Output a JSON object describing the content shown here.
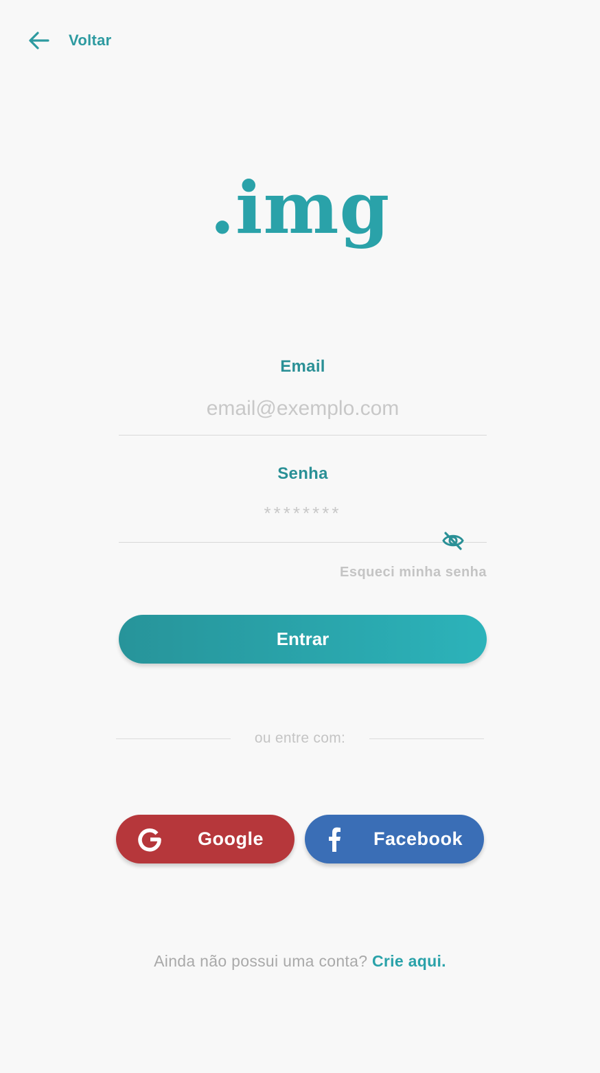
{
  "header": {
    "back_label": "Voltar",
    "back_icon": "arrow-left-icon"
  },
  "logo": {
    "text": ".img"
  },
  "form": {
    "email": {
      "label": "Email",
      "placeholder": "email@exemplo.com",
      "value": ""
    },
    "password": {
      "label": "Senha",
      "placeholder": "********",
      "value": "",
      "toggle_icon": "eye-off-icon"
    },
    "forgot_label": "Esqueci minha senha",
    "submit_label": "Entrar"
  },
  "divider": {
    "text": "ou entre com:"
  },
  "social": {
    "google": {
      "label": "Google",
      "icon": "google-icon",
      "color": "#b6373b"
    },
    "facebook": {
      "label": "Facebook",
      "icon": "facebook-icon",
      "color": "#3a6eb6"
    }
  },
  "signup": {
    "prompt": "Ainda não possui uma conta?",
    "link": "Crie aqui."
  },
  "colors": {
    "accent": "#2aa2a9",
    "background": "#f8f8f8",
    "muted": "#c4c4c4"
  }
}
